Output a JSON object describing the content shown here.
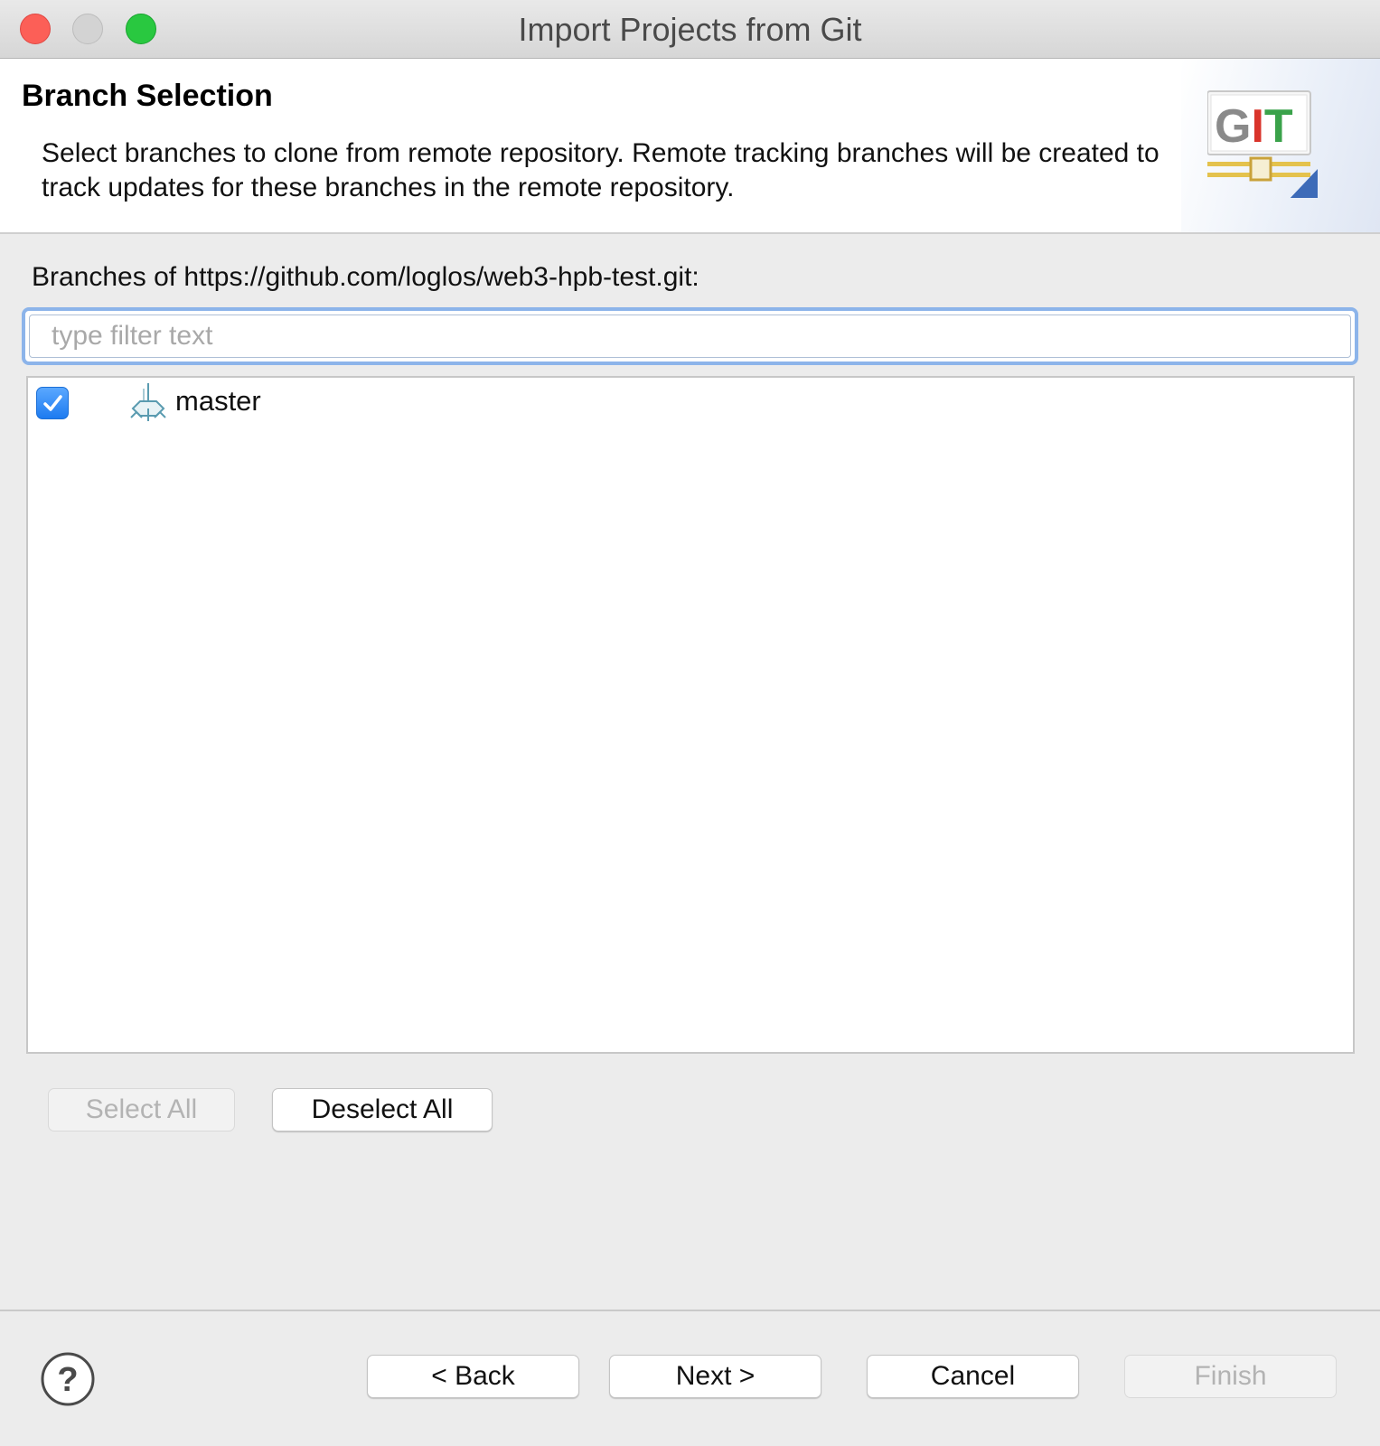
{
  "window": {
    "title": "Import Projects from Git",
    "controls": {
      "close_color": "#fc5f57",
      "minimize_color": "#d3d3d3",
      "maximize_color": "#29c840"
    }
  },
  "header": {
    "title": "Branch Selection",
    "description": "Select branches to clone from remote repository. Remote tracking branches will be created to track updates for these branches in the remote repository.",
    "logo_text": "GIT"
  },
  "branches": {
    "label": "Branches of https://github.com/loglos/web3-hpb-test.git:",
    "filter_placeholder": "type filter text",
    "filter_value": "",
    "items": [
      {
        "name": "master",
        "checked": true,
        "icon": "branch-icon"
      }
    ]
  },
  "selection_buttons": {
    "select_all": "Select All",
    "deselect_all": "Deselect All"
  },
  "footer": {
    "help_icon": "question-mark-icon",
    "back": "< Back",
    "next": "Next >",
    "cancel": "Cancel",
    "finish": "Finish"
  },
  "colors": {
    "accent": "#1e7bf0",
    "focus_ring": "#8cb4ea",
    "logo_g": "#8a8a8a",
    "logo_i": "#d9342b",
    "logo_t": "#3aa24a"
  }
}
